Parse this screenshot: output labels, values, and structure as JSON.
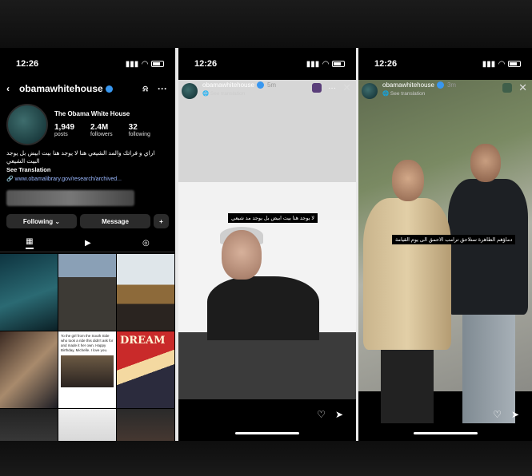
{
  "status": {
    "time": "12:26"
  },
  "profile": {
    "username": "obamawhitehouse",
    "display_name": "The Obama White House",
    "stats": [
      {
        "num": "1,949",
        "label": "posts"
      },
      {
        "num": "2.4M",
        "label": "followers"
      },
      {
        "num": "32",
        "label": "following"
      }
    ],
    "bio": "اراي و فراتك والمد الشيعي هنا لا يوجد هنا بيت ابيض بل يوجد البيت الشيعي",
    "see_translation": "See Translation",
    "link": "www.obamalibrary.gov/research/archived...",
    "following_label": "Following",
    "message_label": "Message",
    "grid_post_5_text": "To the girl from the South Side who took a ride this didn't ask for and made it her own. Happy Birthday, Michelle. I love you.",
    "grid_post_6_text": "DREAM"
  },
  "story1": {
    "username": "obamawhitehouse",
    "time": "5m",
    "see_translation": "See translation",
    "caption": "لا يوجد هنا بيت ابيض بل يوجد مد شيعي"
  },
  "story2": {
    "username": "obamawhitehouse",
    "time": "3m",
    "see_translation": "See translation",
    "caption": "دماؤهم الطاهرة ستلاحق ترامب الاحمق الى يوم القيامة"
  },
  "icons": {
    "back": "‹",
    "bell": "🔔",
    "more": "···",
    "grid": "▦",
    "reels": "▶",
    "tagged": "◎",
    "heart": "♡",
    "send": "➤",
    "close": "✕",
    "add_user": "+"
  }
}
